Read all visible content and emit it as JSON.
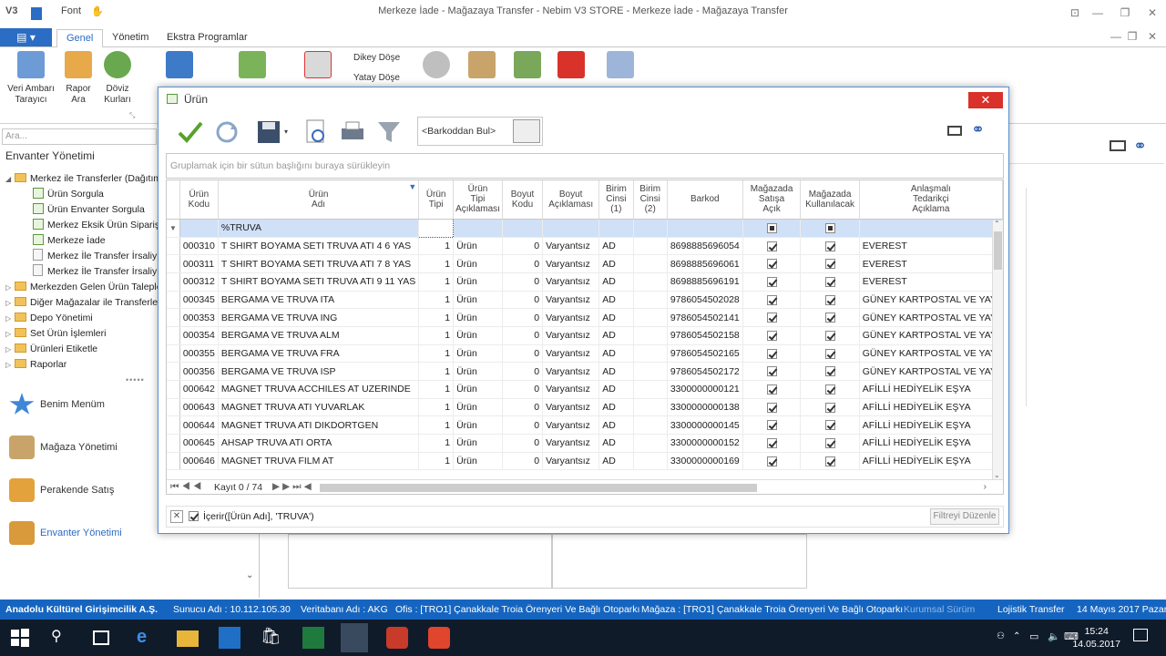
{
  "window": {
    "title": "Merkeze İade - Mağazaya Transfer - Nebim V3 STORE - Merkeze İade - Mağazaya Transfer",
    "quick_access_font": "Font"
  },
  "ribbon": {
    "tabs": [
      {
        "label": "Genel",
        "active": true
      },
      {
        "label": "Yönetim",
        "active": false
      },
      {
        "label": "Ekstra Programlar",
        "active": false
      }
    ],
    "buttons": [
      {
        "label1": "Veri Ambarı",
        "label2": "Tarayıcı"
      },
      {
        "label1": "Rapor",
        "label2": "Ara"
      },
      {
        "label1": "Döviz",
        "label2": "Kurları"
      }
    ],
    "small": {
      "dikey": "Dikey Döşe",
      "yatay": "Yatay Döşe"
    }
  },
  "leftpane": {
    "search_placeholder": "Ara...",
    "title": "Envanter Yönetimi",
    "tree": [
      "Merkez ile Transferler (Dağıtım",
      "Ürün Sorgula",
      "Ürün Envanter Sorgula",
      "Merkez Eksik Ürün Siparişi",
      "Merkeze İade",
      "Merkez İle Transfer İrsaliy",
      "Merkez İle Transfer İrsaliy",
      "Merkezden Gelen Ürün Talepleri",
      "Diğer Mağazalar ile Transferler",
      "Depo Yönetimi",
      "Set Ürün İşlemleri",
      "Ürünleri Etiketle",
      "Raporlar"
    ],
    "nav": [
      "Benim Menüm",
      "Mağaza Yönetimi",
      "Perakende Satış",
      "Envanter Yönetimi"
    ]
  },
  "dialog": {
    "title": "Ürün",
    "barcode_placeholder": "<Barkoddan Bul>",
    "group_hint": "Gruplamak için bir sütun başlığını buraya sürükleyin",
    "columns": [
      [
        "Ürün",
        "Kodu"
      ],
      [
        "Ürün",
        "Adı"
      ],
      [
        "Ürün",
        "Tipi"
      ],
      [
        "Ürün",
        "Tipi",
        "Açıklaması"
      ],
      [
        "Boyut",
        "Kodu"
      ],
      [
        "Boyut",
        "Açıklaması"
      ],
      [
        "Birim",
        "Cinsi",
        "(1)"
      ],
      [
        "Birim",
        "Cinsi",
        "(2)"
      ],
      [
        "Barkod"
      ],
      [
        "Mağazada",
        "Satışa",
        "Açık"
      ],
      [
        "Mağazada",
        "Kullanılacak"
      ],
      [
        "Anlaşmalı",
        "Tedarikçi",
        "Açıklama"
      ]
    ],
    "filter_value": "%TRUVA",
    "rows": [
      [
        "000310",
        "T SHIRT BOYAMA SETI TRUVA ATI 4 6 YAS",
        "1",
        "Ürün",
        "0",
        "Varyantsız",
        "AD",
        "",
        "8698885696054",
        "EVEREST"
      ],
      [
        "000311",
        "T SHIRT BOYAMA SETI TRUVA ATI 7 8 YAS",
        "1",
        "Ürün",
        "0",
        "Varyantsız",
        "AD",
        "",
        "8698885696061",
        "EVEREST"
      ],
      [
        "000312",
        "T SHIRT BOYAMA SETI TRUVA ATI 9 11 YAS",
        "1",
        "Ürün",
        "0",
        "Varyantsız",
        "AD",
        "",
        "8698885696191",
        "EVEREST"
      ],
      [
        "000345",
        "BERGAMA VE TRUVA ITA",
        "1",
        "Ürün",
        "0",
        "Varyantsız",
        "AD",
        "",
        "9786054502028",
        "GÜNEY KARTPOSTAL VE YAYI"
      ],
      [
        "000353",
        "BERGAMA VE TRUVA ING",
        "1",
        "Ürün",
        "0",
        "Varyantsız",
        "AD",
        "",
        "9786054502141",
        "GÜNEY KARTPOSTAL VE YAYI"
      ],
      [
        "000354",
        "BERGAMA VE TRUVA ALM",
        "1",
        "Ürün",
        "0",
        "Varyantsız",
        "AD",
        "",
        "9786054502158",
        "GÜNEY KARTPOSTAL VE YAYI"
      ],
      [
        "000355",
        "BERGAMA VE TRUVA FRA",
        "1",
        "Ürün",
        "0",
        "Varyantsız",
        "AD",
        "",
        "9786054502165",
        "GÜNEY KARTPOSTAL VE YAYI"
      ],
      [
        "000356",
        "BERGAMA VE TRUVA ISP",
        "1",
        "Ürün",
        "0",
        "Varyantsız",
        "AD",
        "",
        "9786054502172",
        "GÜNEY KARTPOSTAL VE YAYI"
      ],
      [
        "000642",
        "MAGNET TRUVA ACCHILES AT UZERINDE",
        "1",
        "Ürün",
        "0",
        "Varyantsız",
        "AD",
        "",
        "3300000000121",
        "AFİLLİ HEDİYELİK EŞYA"
      ],
      [
        "000643",
        "MAGNET TRUVA ATI YUVARLAK",
        "1",
        "Ürün",
        "0",
        "Varyantsız",
        "AD",
        "",
        "3300000000138",
        "AFİLLİ HEDİYELİK EŞYA"
      ],
      [
        "000644",
        "MAGNET TRUVA ATI DIKDORTGEN",
        "1",
        "Ürün",
        "0",
        "Varyantsız",
        "AD",
        "",
        "3300000000145",
        "AFİLLİ HEDİYELİK EŞYA"
      ],
      [
        "000645",
        "AHSAP TRUVA ATI ORTA",
        "1",
        "Ürün",
        "0",
        "Varyantsız",
        "AD",
        "",
        "3300000000152",
        "AFİLLİ HEDİYELİK EŞYA"
      ],
      [
        "000646",
        "MAGNET TRUVA FILM AT",
        "1",
        "Ürün",
        "0",
        "Varyantsız",
        "AD",
        "",
        "3300000000169",
        "AFİLLİ HEDİYELİK EŞYA"
      ]
    ],
    "record_nav": "Kayıt 0 / 74",
    "filter_text": "İçerir([Ürün Adı], 'TRUVA')",
    "filter_edit": "Filtreyi Düzenle"
  },
  "statusbar": {
    "company": "Anadolu Kültürel Girişimcilik A.Ş.",
    "server": "Sunucu Adı : 10.112.105.30",
    "db": "Veritabanı Adı : AKG",
    "office": "Ofis : [TRO1]  Çanakkale Troia Örenyeri Ve Bağlı Otoparkı",
    "store": "Mağaza : [TRO1]  Çanakkale Troia Örenyeri Ve Bağlı Otoparkı",
    "edition": "Kurumsal Sürüm",
    "module": "Lojistik Transfer",
    "date": "14 Mayıs 2017 Pazar"
  },
  "taskbar": {
    "time": "15:24",
    "date": "14.05.2017"
  }
}
